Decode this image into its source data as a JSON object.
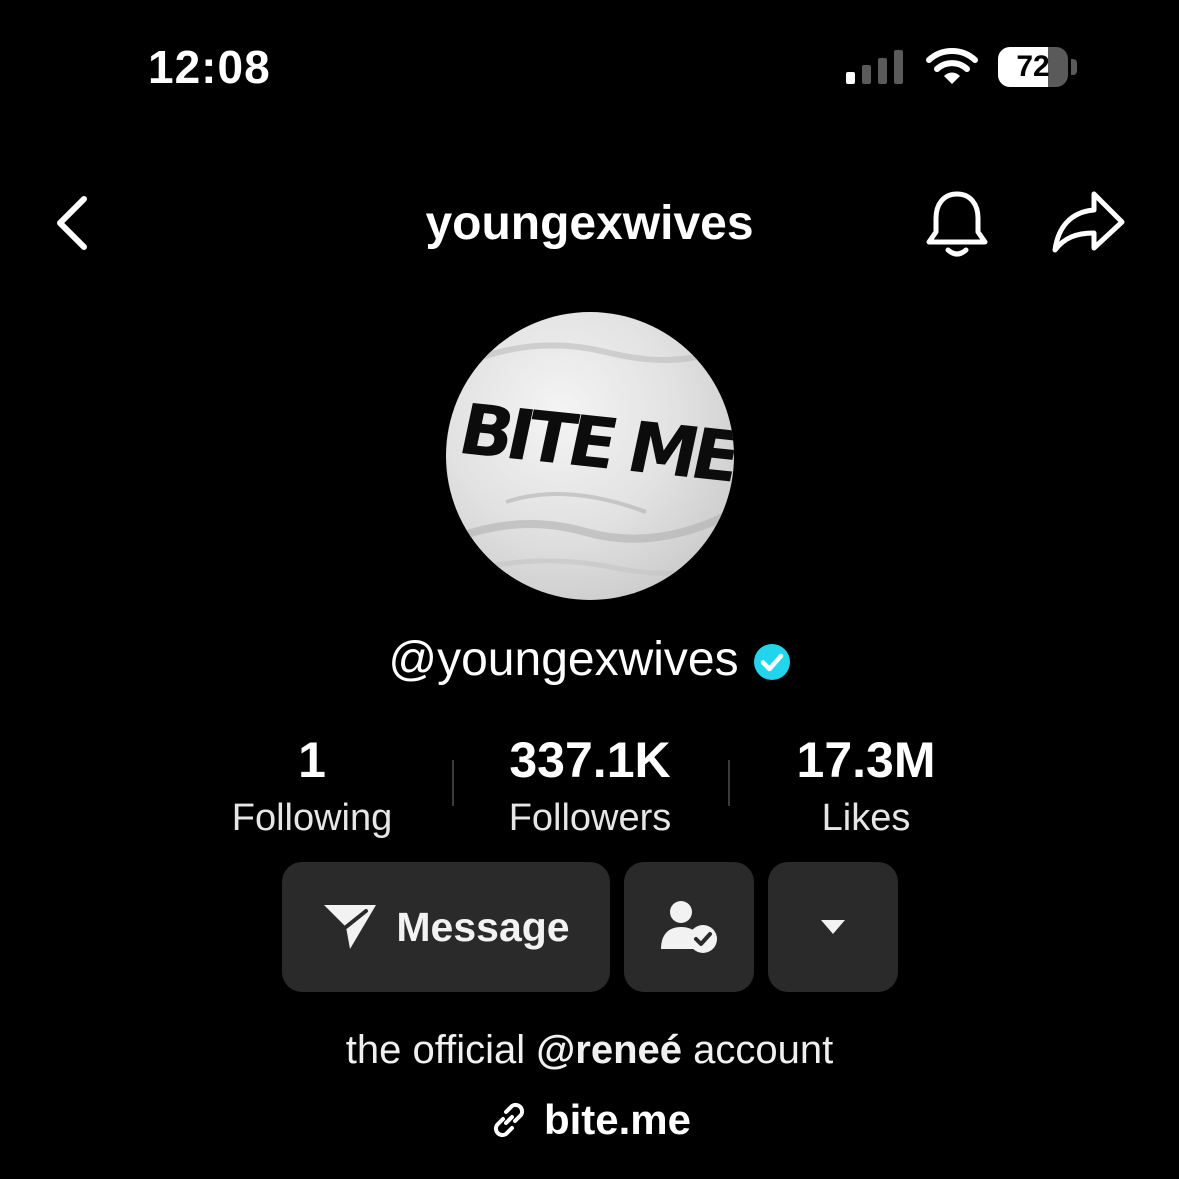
{
  "status_bar": {
    "time": "12:08",
    "battery_level": "72",
    "battery_fraction": 0.72,
    "icons": [
      "signal-icon",
      "wifi-icon",
      "battery-icon"
    ]
  },
  "nav": {
    "title": "youngexwives",
    "icons": [
      "back-chevron-icon",
      "bell-icon",
      "share-arrow-icon"
    ]
  },
  "profile": {
    "avatar_text": "BITE ME",
    "handle": "@youngexwives",
    "verified_color": "#20D5EC"
  },
  "stats": [
    {
      "value": "1",
      "label": "Following"
    },
    {
      "value": "337.1K",
      "label": "Followers"
    },
    {
      "value": "17.3M",
      "label": "Likes"
    }
  ],
  "actions": {
    "message_label": "Message",
    "icons": [
      "send-icon",
      "friends-check-icon",
      "dropdown-caret-icon"
    ]
  },
  "bio": {
    "prefix": "the official ",
    "mention": "@reneé",
    "suffix": " account",
    "link": "bite.me"
  },
  "colors": {
    "background": "#000000",
    "button": "#2A2A2A",
    "text": "#FFFFFF"
  }
}
